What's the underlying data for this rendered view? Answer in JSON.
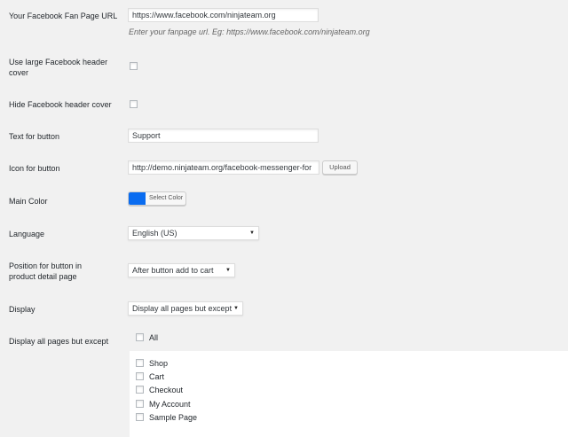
{
  "fan_page": {
    "label": "Your Facebook Fan Page URL",
    "value": "https://www.facebook.com/ninjateam.org",
    "description": "Enter your fanpage url. Eg: https://www.facebook.com/ninjateam.org"
  },
  "large_header": {
    "label_line1": "Use large Facebook header",
    "label_line2": "cover",
    "checked": false
  },
  "hide_header": {
    "label": "Hide Facebook header cover",
    "checked": false
  },
  "button_text": {
    "label": "Text for button",
    "value": "Support"
  },
  "button_icon": {
    "label": "Icon for button",
    "value": "http://demo.ninjateam.org/facebook-messenger-for",
    "upload_label": "Upload"
  },
  "main_color": {
    "label": "Main Color",
    "color": "#0a6cf0",
    "select_label": "Select Color"
  },
  "language": {
    "label": "Language",
    "selected": "English (US)"
  },
  "position": {
    "label_line1": "Position for button in",
    "label_line2": "product detail page",
    "selected": "After button add to cart"
  },
  "display": {
    "label": "Display",
    "selected": "Display all pages but except"
  },
  "except": {
    "label": "Display all pages but except",
    "all_label": "All",
    "pages": [
      {
        "label": "Shop",
        "checked": false
      },
      {
        "label": "Cart",
        "checked": false
      },
      {
        "label": "Checkout",
        "checked": false
      },
      {
        "label": "My Account",
        "checked": false
      },
      {
        "label": "Sample Page",
        "checked": false
      }
    ]
  }
}
